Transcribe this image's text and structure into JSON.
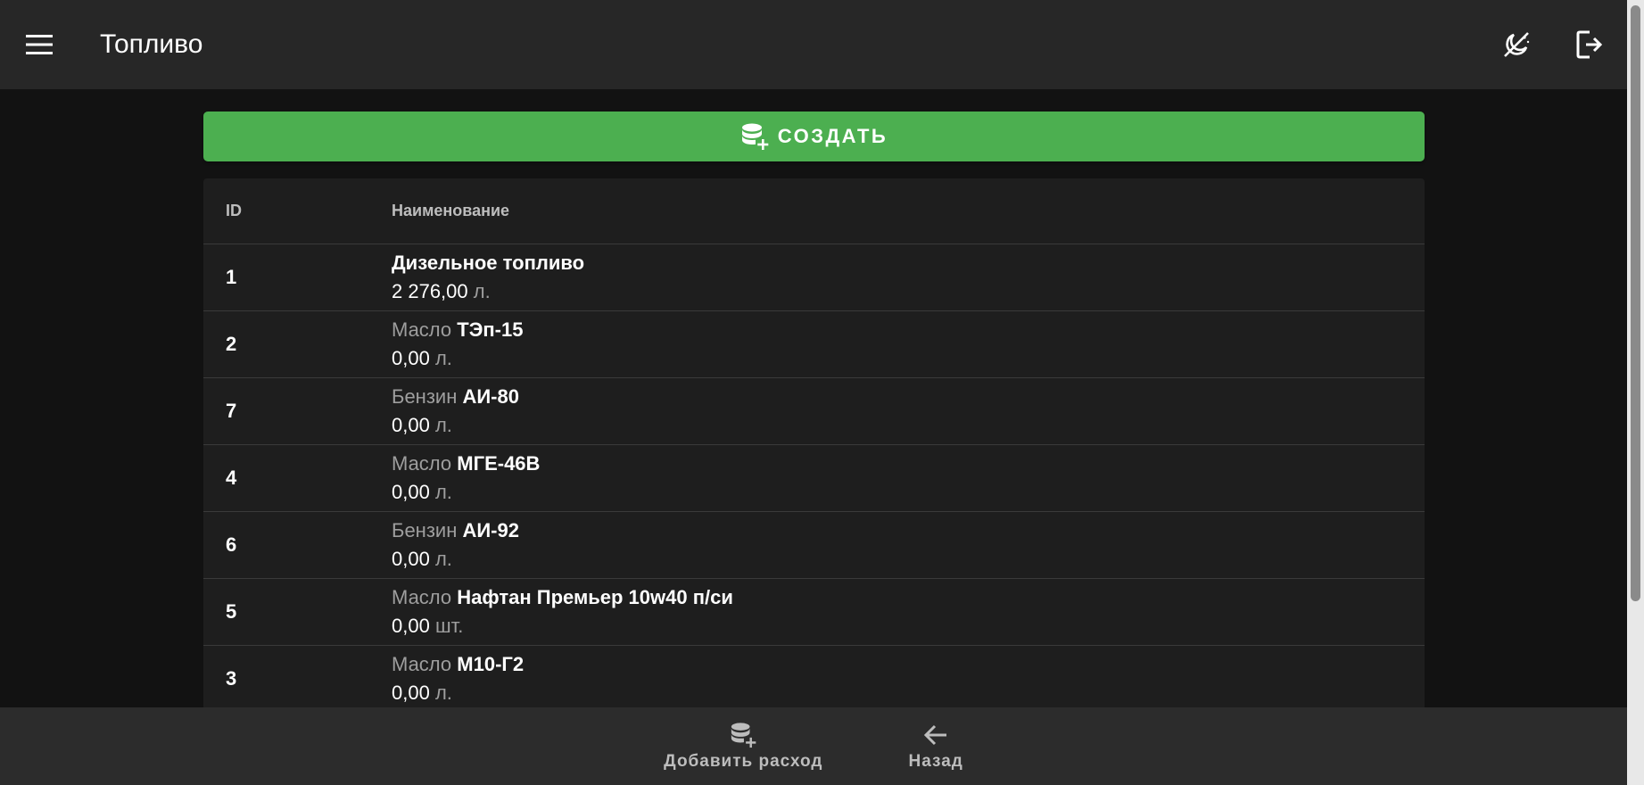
{
  "header": {
    "title": "Топливо",
    "icons": {
      "menu": "menu-icon",
      "theme": "theme-toggle-icon",
      "logout": "logout-icon"
    }
  },
  "actions": {
    "create_label": "Создать",
    "create_icon": "database-plus-icon",
    "accent_color": "#4caf50"
  },
  "table": {
    "columns": [
      "ID",
      "Наименование"
    ],
    "rows": [
      {
        "id": "1",
        "type": "",
        "name": "Дизельное топливо",
        "qty": "2 276,00",
        "unit": "л."
      },
      {
        "id": "2",
        "type": "Масло",
        "name": "ТЭп-15",
        "qty": "0,00",
        "unit": "л."
      },
      {
        "id": "7",
        "type": "Бензин",
        "name": "АИ-80",
        "qty": "0,00",
        "unit": "л."
      },
      {
        "id": "4",
        "type": "Масло",
        "name": "МГЕ-46В",
        "qty": "0,00",
        "unit": "л."
      },
      {
        "id": "6",
        "type": "Бензин",
        "name": "АИ-92",
        "qty": "0,00",
        "unit": "л."
      },
      {
        "id": "5",
        "type": "Масло",
        "name": "Нафтан Премьер 10w40 п/си",
        "qty": "0,00",
        "unit": "шт."
      },
      {
        "id": "3",
        "type": "Масло",
        "name": "М10-Г2",
        "qty": "0,00",
        "unit": "л."
      }
    ]
  },
  "bottom_nav": {
    "add_expense_label": "Добавить расход",
    "back_label": "Назад"
  }
}
